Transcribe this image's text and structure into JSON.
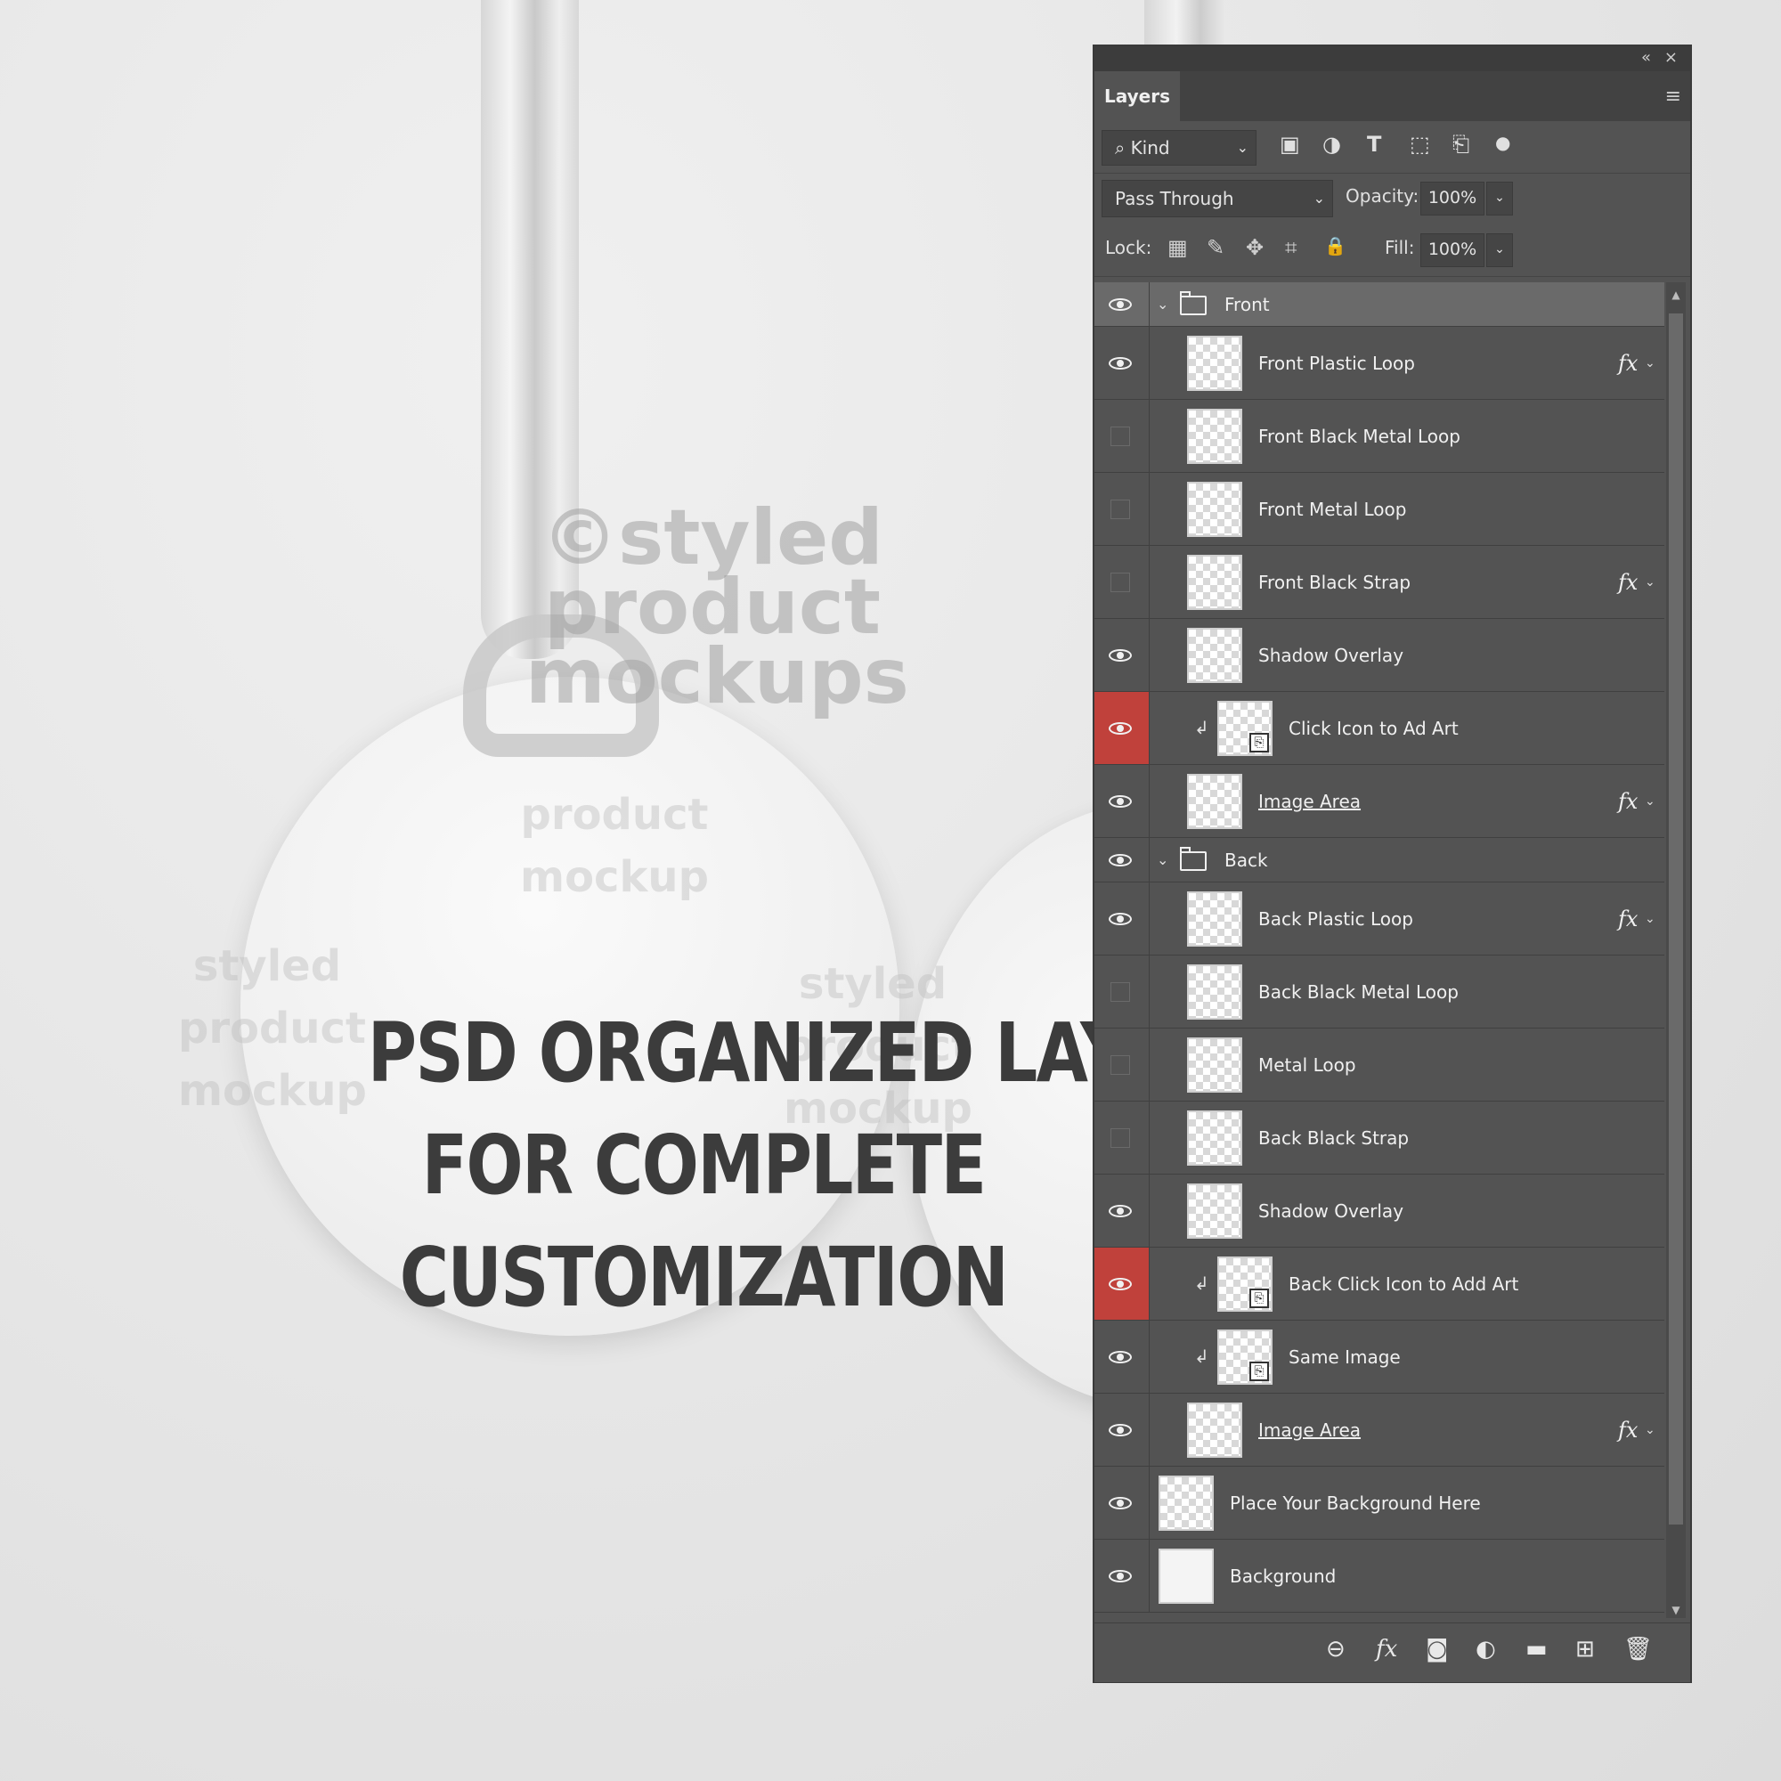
{
  "watermark": {
    "main": "©styled\nproduct\nmockups",
    "small_1": "product\nmockup",
    "small_2": "styled\nproduct\nmockup",
    "small_3": "styled\nproduct\nmockup"
  },
  "headline": {
    "line1": "PSD ORGANIZED LAYERS",
    "line2": "FOR COMPLETE",
    "line3": "CUSTOMIZATION"
  },
  "panel": {
    "collapse_glyph": "«",
    "close_glyph": "×",
    "tab_label": "Layers",
    "menu_glyph": "≡",
    "filter": {
      "kind_label": "Kind",
      "search_glyph": "⌕",
      "chevron_glyph": "⌄",
      "icons": [
        "image-filter-icon",
        "adjustment-filter-icon",
        "type-filter-icon",
        "shape-filter-icon",
        "smart-object-filter-icon",
        "filter-toggle-icon"
      ],
      "glyphs": [
        "▣",
        "◑",
        "T",
        "⬚",
        "⎗",
        "●"
      ]
    },
    "blend_mode": "Pass Through",
    "opacity_label": "Opacity:",
    "opacity_value": "100%",
    "lock_label": "Lock:",
    "lock_icons": [
      "lock-transparent-icon",
      "lock-image-icon",
      "lock-position-icon",
      "lock-artboard-icon",
      "lock-all-icon"
    ],
    "lock_glyphs": [
      "▦",
      "✎",
      "✥",
      "⌗",
      "🔒"
    ],
    "fill_label": "Fill:",
    "fill_value": "100%",
    "layers": [
      {
        "type": "group",
        "name": "Front",
        "visible": true
      },
      {
        "type": "layer",
        "name": "Front Plastic Loop",
        "visible": true,
        "fx": true
      },
      {
        "type": "layer",
        "name": "Front Black Metal Loop",
        "visible": false,
        "fx": false
      },
      {
        "type": "layer",
        "name": "Front Metal Loop",
        "visible": false,
        "fx": false
      },
      {
        "type": "layer",
        "name": "Front Black Strap",
        "visible": false,
        "fx": true
      },
      {
        "type": "layer",
        "name": "Shadow Overlay",
        "visible": true,
        "fx": false
      },
      {
        "type": "smart",
        "name": "Click Icon to Ad Art",
        "visible": true,
        "highlight": true,
        "clipped": true
      },
      {
        "type": "layer",
        "name": "Image Area",
        "visible": true,
        "fx": true,
        "underline": true
      },
      {
        "type": "group",
        "name": "Back",
        "visible": true
      },
      {
        "type": "layer",
        "name": "Back Plastic Loop",
        "visible": true,
        "fx": true
      },
      {
        "type": "layer",
        "name": "Back Black Metal Loop",
        "visible": false,
        "fx": false
      },
      {
        "type": "layer",
        "name": "Metal Loop",
        "visible": false,
        "fx": false
      },
      {
        "type": "layer",
        "name": "Back Black Strap",
        "visible": false,
        "fx": false
      },
      {
        "type": "layer",
        "name": "Shadow Overlay",
        "visible": true,
        "fx": false
      },
      {
        "type": "smart",
        "name": "Back Click Icon to Add Art",
        "visible": true,
        "highlight": true,
        "clipped": true
      },
      {
        "type": "smart",
        "name": "Same Image",
        "visible": true,
        "highlight": false,
        "clipped": true
      },
      {
        "type": "layer",
        "name": "Image Area",
        "visible": true,
        "fx": true,
        "underline": true
      },
      {
        "type": "top",
        "name": "Place Your Background Here",
        "visible": true
      },
      {
        "type": "top-plain",
        "name": "Background",
        "visible": true
      }
    ],
    "fx_label": "fx",
    "fx_chevron": "⌄",
    "group_chevron": "⌄",
    "clip_arrow": "↲",
    "smart_badge": "⎘",
    "bottom_icons": [
      "link-layers-icon",
      "fx-icon",
      "mask-icon",
      "adjustment-layer-icon",
      "new-group-icon",
      "new-layer-icon",
      "delete-icon"
    ],
    "bottom_glyphs": [
      "⊖",
      "fx",
      "◙",
      "◐",
      "▬",
      "⊞",
      "🗑"
    ]
  }
}
